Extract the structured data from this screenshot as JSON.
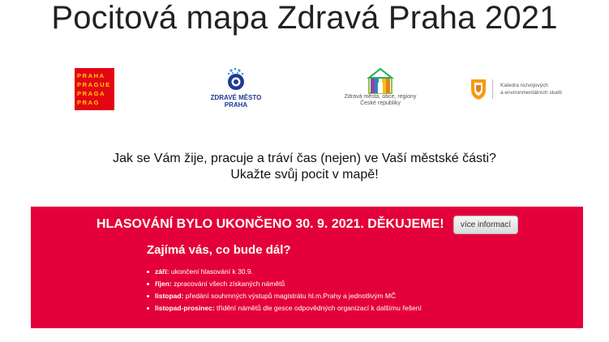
{
  "page": {
    "title": "Pocitová mapa Zdravá Praha 2021"
  },
  "logos": {
    "praha": {
      "lines": [
        "PRAHA",
        "PRAGUE",
        "PRAGA",
        "PRAG"
      ]
    },
    "zdrave_mesto": {
      "line1": "ZDRAVÉ MĚSTO",
      "line2": "PRAHA"
    },
    "zdrava_mesta": {
      "line1": "Zdravá města, obce, regiony",
      "line2": "České republiky"
    },
    "katedra": {
      "line1": "Katedra rozvojových",
      "line2": "a environmentálních studií"
    }
  },
  "intro": {
    "line1": "Jak se Vám žije, pracuje a tráví čas (nejen) ve Vaší městské části?",
    "line2": "Ukažte svůj pocit v mapě!"
  },
  "banner": {
    "headline": "HLASOVÁNÍ BYLO UKONČENO 30. 9. 2021. DĚKUJEME!",
    "more_button": "více informací",
    "subtitle": "Zajímá vás, co bude dál?",
    "timeline": [
      {
        "label": "září:",
        "text": " ukončení hlasování k 30.9."
      },
      {
        "label": "říjen:",
        "text": " zpracování všech získaných námětů"
      },
      {
        "label": "listopad:",
        "text": " předání souhrnných výstupů magistrátu hl.m.Prahy a jednotlivým MČ"
      },
      {
        "label": "listopad-prosinec:",
        "text": " třídění námětů dle gesce odpovědných organizací k dalšímu řešení"
      }
    ],
    "color": "#e4003a"
  }
}
